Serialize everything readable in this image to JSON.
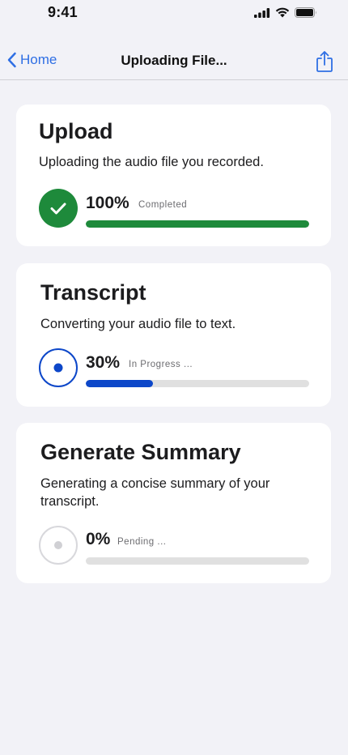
{
  "status_bar": {
    "time": "9:41"
  },
  "nav": {
    "back_label": "Home",
    "title": "Uploading File..."
  },
  "colors": {
    "accent": "#2f6fe4",
    "success": "#1e8a3b",
    "progress": "#0d47c9",
    "pending": "#d8d8dc"
  },
  "steps": [
    {
      "title": "Upload",
      "description": "Uploading the audio file you recorded.",
      "percent_label": "100%",
      "progress": 1.0,
      "state": "Completed",
      "icon": "checkmark-icon"
    },
    {
      "title": "Transcript",
      "description": "Converting your audio file to text.",
      "percent_label": "30%",
      "progress": 0.3,
      "state": "In Progress ...",
      "icon": "in-progress-dot-icon"
    },
    {
      "title": "Generate Summary",
      "description": "Generating a concise summary of your transcript.",
      "percent_label": "0%",
      "progress": 0.0,
      "state": "Pending ...",
      "icon": "pending-dot-icon"
    }
  ]
}
